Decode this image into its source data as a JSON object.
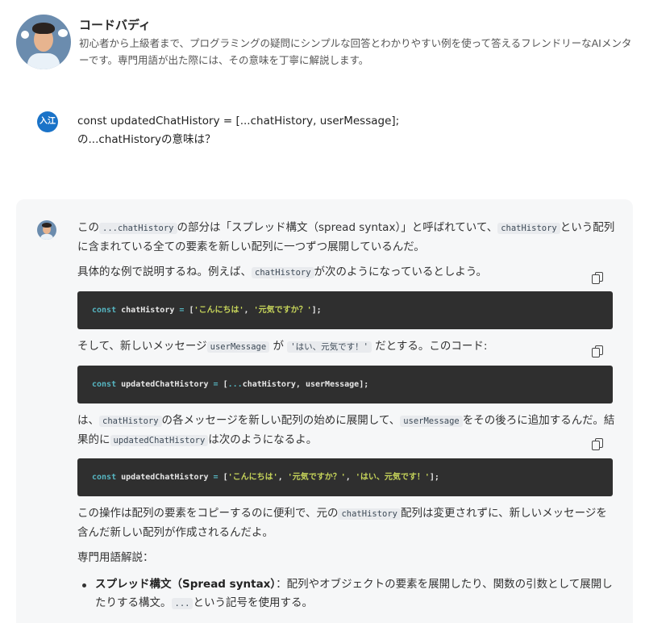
{
  "bot": {
    "name": "コードバディ",
    "description": "初心者から上級者まで、プログラミングの疑問にシンプルな回答とわかりやすい例を使って答えるフレンドリーなAIメンターです。専門用語が出た際には、その意味を丁寧に解説します。"
  },
  "user": {
    "badge": "入江",
    "line1": "const updatedChatHistory = [...chatHistory, userMessage];",
    "line2": "の...chatHistoryの意味は？"
  },
  "answer": {
    "p1": {
      "a": "この",
      "code1": "...chatHistory",
      "b": "の部分は「スプレッド構文（spread syntax）」と呼ばれていて、",
      "code2": "chatHistory",
      "c": "という配列に含まれている全ての要素を新しい配列に一つずつ展開しているんだ。"
    },
    "p2": {
      "a": "具体的な例で説明するね。例えば、",
      "code1": "chatHistory",
      "b": "が次のようになっているとしよう。"
    },
    "code1": {
      "kw": "const",
      "name": "chatHistory",
      "eq": "=",
      "open": "[",
      "s1": "'こんにちは'",
      "comma": ",",
      "s2": "'元気ですか？'",
      "close": "];"
    },
    "p3": {
      "a": "そして、新しいメッセージ",
      "code1": "userMessage",
      "b": "が",
      "code2": "'はい、元気です！'",
      "c": "だとする。このコード:"
    },
    "code2": {
      "kw": "const",
      "name": "updatedChatHistory",
      "eq": "=",
      "open": "[",
      "spread": "...",
      "rest": "chatHistory, userMessage];"
    },
    "p4": {
      "a": "は、",
      "code1": "chatHistory",
      "b": "の各メッセージを新しい配列の始めに展開して、",
      "code2": "userMessage",
      "c": "をその後ろに追加するんだ。結果的に",
      "code3": "updatedChatHistory",
      "d": "は次のようになるよ。"
    },
    "code3": {
      "kw": "const",
      "name": "updatedChatHistory",
      "eq": "=",
      "open": "[",
      "s1": "'こんにちは'",
      "c1": ",",
      "s2": "'元気ですか？'",
      "c2": ",",
      "s3": "'はい、元気です！'",
      "close": "];"
    },
    "p5": {
      "a": "この操作は配列の要素をコピーするのに便利で、元の",
      "code1": "chatHistory",
      "b": "配列は変更されずに、新しいメッセージを含んだ新しい配列が作成されるんだよ。"
    },
    "p6": "専門用語解説：",
    "bullet1": {
      "term": "スプレッド構文（Spread syntax）",
      "a": "：配列やオブジェクトの要素を展開したり、関数の引数として展開したりする構文。",
      "code1": "...",
      "b": "という記号を使用する。"
    }
  },
  "icons": {
    "copy": "copy-icon",
    "avatar": "avatar-illustration"
  },
  "colors": {
    "user_badge": "#1a73c8",
    "code_bg": "#2f2f2f",
    "keyword": "#56b6c2",
    "string": "#c7d55a",
    "answer_bg": "#f6f7f8"
  }
}
